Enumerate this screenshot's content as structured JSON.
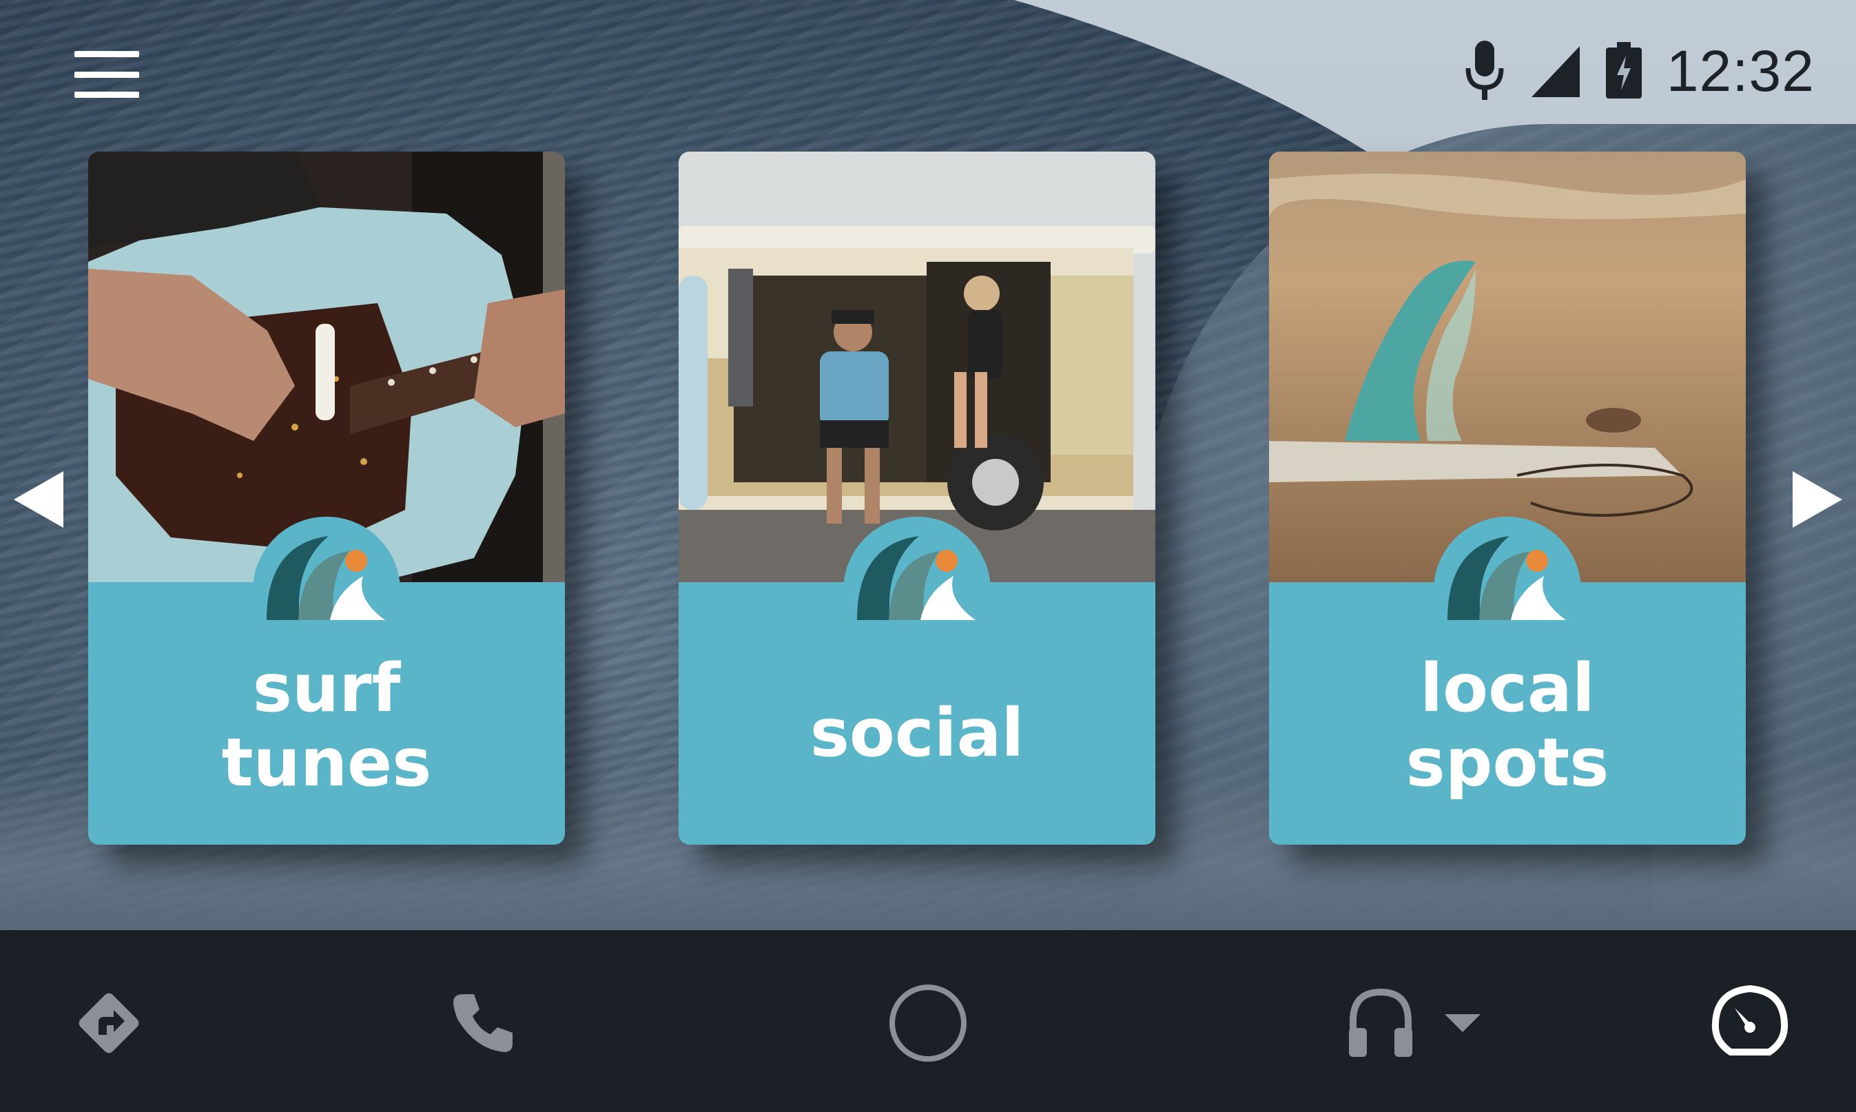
{
  "status_bar": {
    "time": "12:32",
    "icons": [
      "menu-icon",
      "microphone-icon",
      "cell-signal-icon",
      "battery-charging-icon"
    ]
  },
  "cards": [
    {
      "id": "surf-tunes",
      "title_lines": [
        "surf",
        "tunes"
      ],
      "photo": "guitar-photo",
      "badge": "wave-logo-icon"
    },
    {
      "id": "social",
      "title_lines": [
        "social"
      ],
      "photo": "van-photo",
      "badge": "wave-logo-icon"
    },
    {
      "id": "local-spots",
      "title_lines": [
        "local",
        "spots"
      ],
      "photo": "surfboard-fin-photo",
      "badge": "wave-logo-icon"
    }
  ],
  "carousel": {
    "prev_icon": "triangle-left-icon",
    "next_icon": "triangle-right-icon"
  },
  "nav_bar": {
    "items": [
      "navigation-icon",
      "phone-icon",
      "home-circle-icon",
      "headphones-icon",
      "dropdown-caret-icon",
      "dashboard-gauge-icon"
    ]
  },
  "colors": {
    "card_panel": "#5bb5c8",
    "nav_bar": "#1b2027",
    "logo_dark": "#1f5a60",
    "logo_mid": "#5a8d8c",
    "logo_sun": "#e88a3a"
  }
}
